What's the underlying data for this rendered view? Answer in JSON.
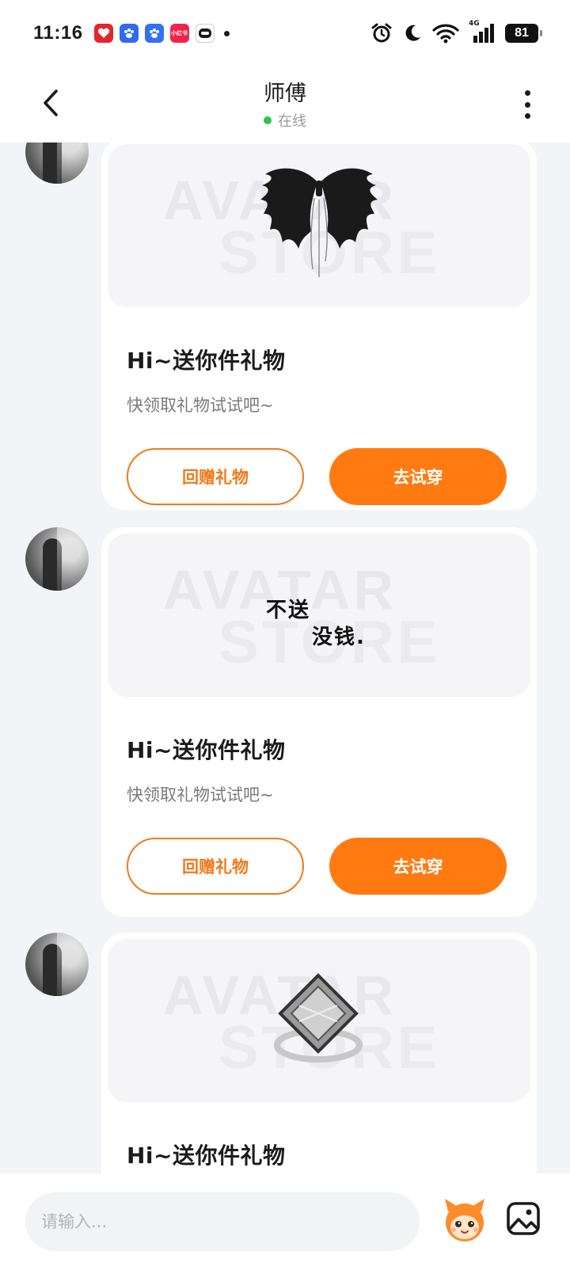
{
  "status_bar": {
    "time": "11:16",
    "network": "4G",
    "battery": "81",
    "apps": [
      {
        "name": "app1",
        "color": "#e3262b",
        "label": ""
      },
      {
        "name": "baidu-netdisk",
        "color": "#2f6bf2",
        "label": ""
      },
      {
        "name": "baidu",
        "color": "#3370f5",
        "label": ""
      },
      {
        "name": "xiaohongshu",
        "color": "#f0244a",
        "label": "小红书"
      },
      {
        "name": "app5",
        "color": "#7b54e6",
        "label": ""
      }
    ]
  },
  "header": {
    "title": "师傅",
    "online_status": "在线"
  },
  "cards": [
    {
      "image": "black-wings",
      "watermark_top": "AVATAR",
      "watermark_bottom": "STORE",
      "title": "Hi~送你件礼物",
      "subtitle": "快领取礼物试试吧~",
      "btn_return": "回赠礼物",
      "btn_try": "去试穿"
    },
    {
      "image": "text-sticker",
      "image_text_1": "不送",
      "image_text_2": "没钱.",
      "watermark_top": "AVATAR",
      "watermark_bottom": "STORE",
      "title": "Hi~送你件礼物",
      "subtitle": "快领取礼物试试吧~",
      "btn_return": "回赠礼物",
      "btn_try": "去试穿"
    },
    {
      "image": "crystal-ring",
      "watermark_top": "AVATAR",
      "watermark_bottom": "STORE",
      "title": "Hi~送你件礼物"
    }
  ],
  "composer": {
    "placeholder": "请输入..."
  },
  "colors": {
    "accent": "#ff7a10",
    "online": "#2fc34f"
  }
}
